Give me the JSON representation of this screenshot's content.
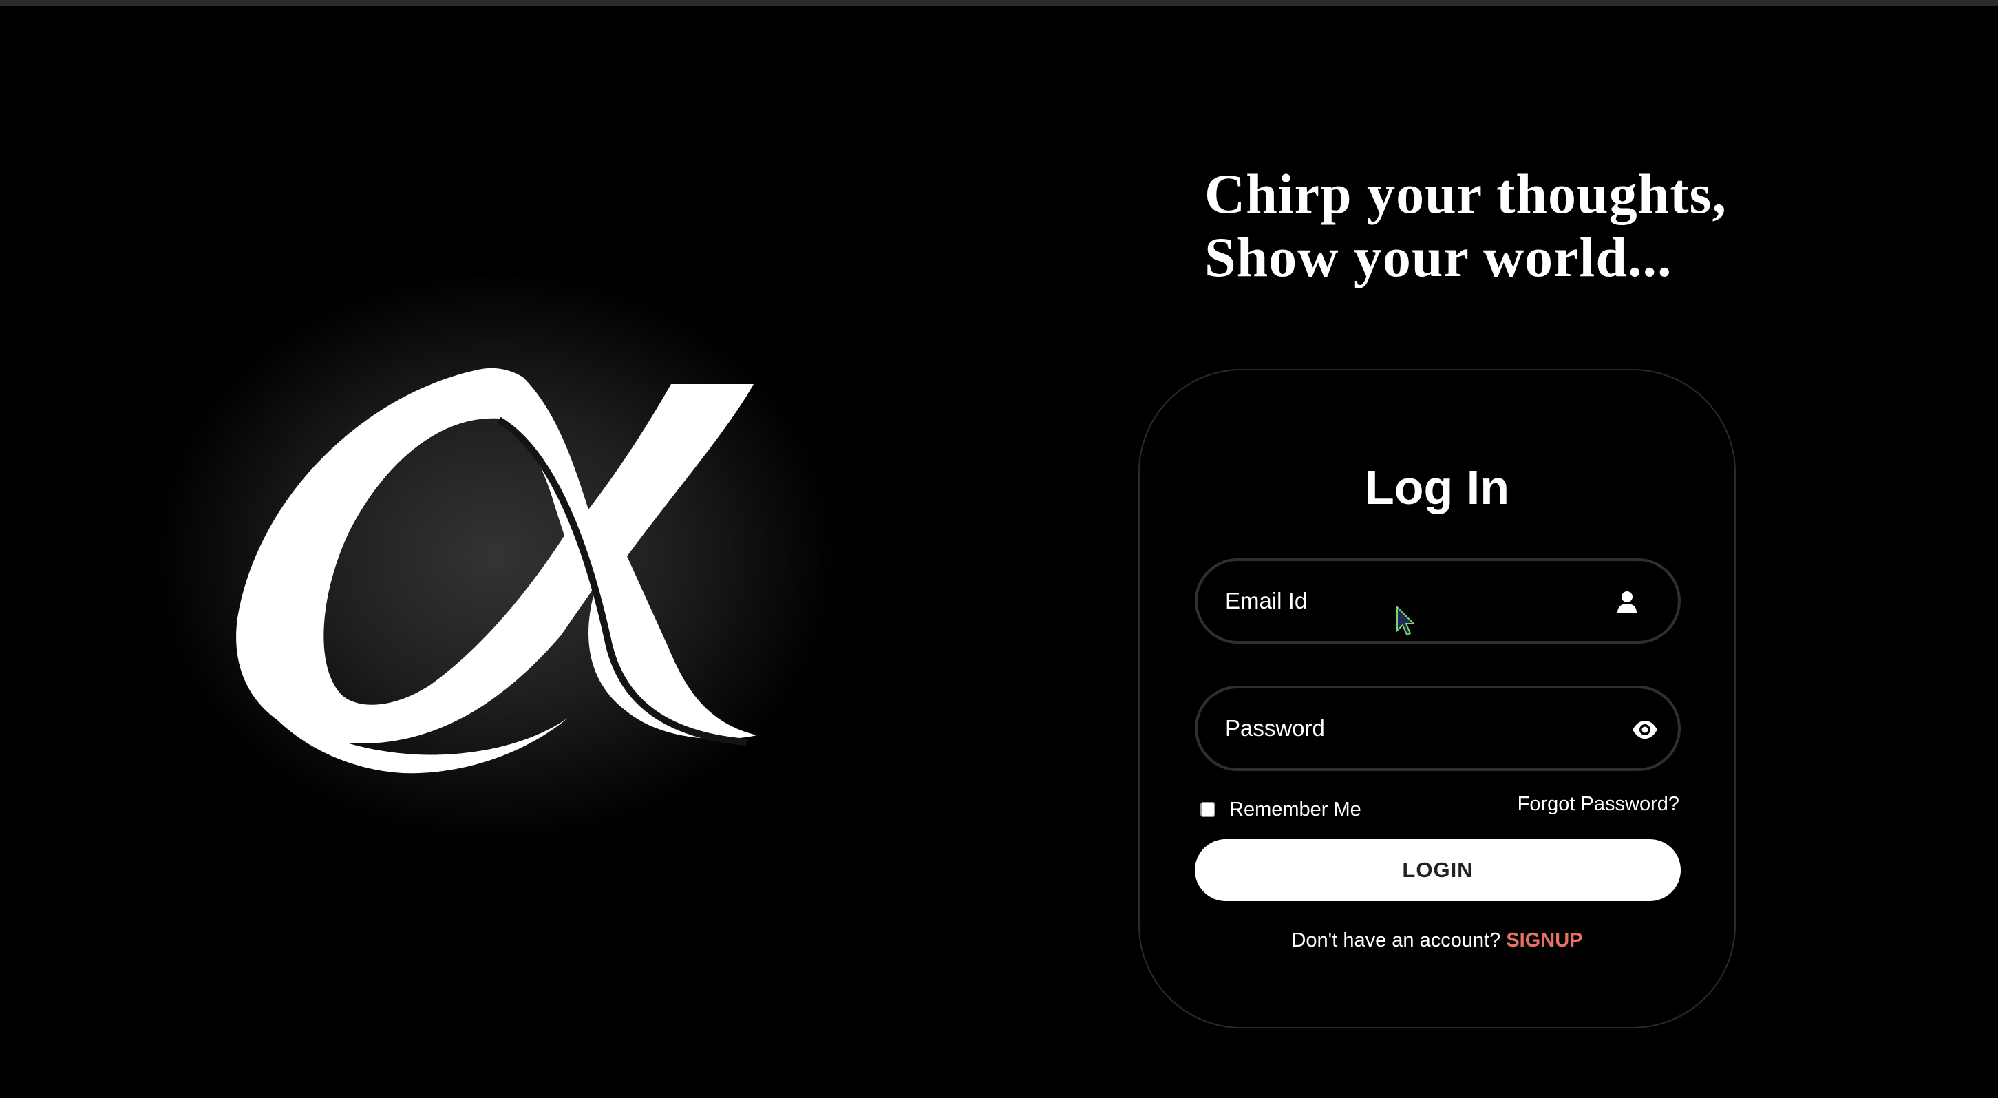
{
  "tagline": {
    "line1": "Chirp your thoughts,",
    "line2": "Show your world..."
  },
  "brand": {
    "logo_icon": "alpha-logo-icon"
  },
  "login": {
    "title": "Log In",
    "email_placeholder": "Email Id",
    "email_value": "",
    "email_icon": "user-icon",
    "password_placeholder": "Password",
    "password_value": "",
    "password_icon": "eye-icon",
    "remember_label": "Remember Me",
    "remember_checked": false,
    "forgot_label": "Forgot Password?",
    "button_label": "LOGIN",
    "signup_prompt": "Don't have an account?",
    "signup_label": "SIGNUP"
  },
  "colors": {
    "background": "#000000",
    "accent": "#e6735f",
    "button_bg": "#ffffff",
    "button_text": "#222222",
    "card_border": "#2b2b2b"
  }
}
